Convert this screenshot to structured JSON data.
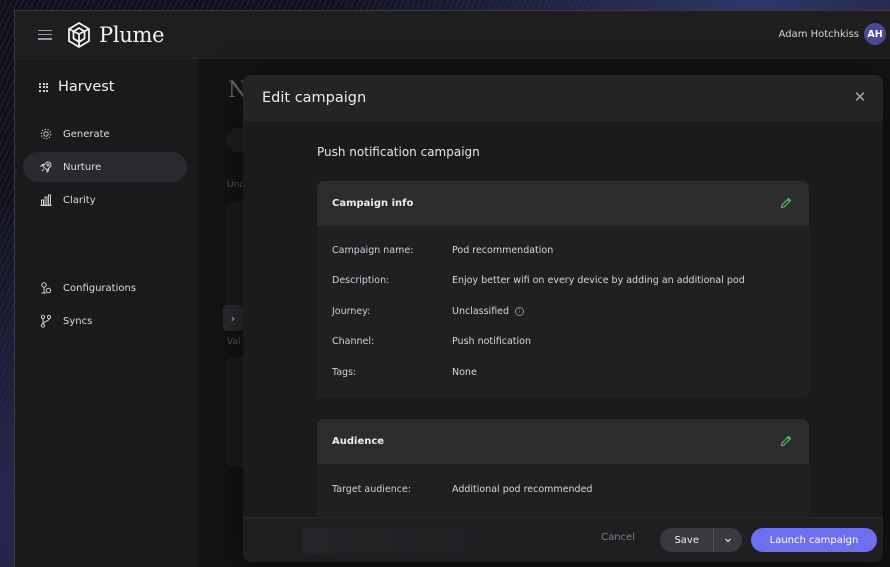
{
  "topbar": {
    "brand": "Plume",
    "user_name": "Adam Hotchkiss",
    "user_initials": "AH"
  },
  "sidebar": {
    "product": "Harvest",
    "items": [
      {
        "label": "Generate",
        "icon": "generate-icon",
        "active": false
      },
      {
        "label": "Nurture",
        "icon": "rocket-icon",
        "active": true
      },
      {
        "label": "Clarity",
        "icon": "bar-chart-icon",
        "active": false
      },
      {
        "label": "Configurations",
        "icon": "configurations-icon",
        "active": false
      },
      {
        "label": "Syncs",
        "icon": "branch-icon",
        "active": false
      }
    ]
  },
  "background": {
    "title_fragment": "N",
    "text_fragment_1": "Unc",
    "text_fragment_2": "Val"
  },
  "modal": {
    "title": "Edit campaign",
    "section_heading": "Push notification campaign",
    "campaign_info": {
      "title": "Campaign info",
      "rows": [
        {
          "key": "Campaign name:",
          "value": "Pod recommendation"
        },
        {
          "key": "Description:",
          "value": "Enjoy better wifi on every device by adding an additional pod"
        },
        {
          "key": "Journey:",
          "value": "Unclassified"
        },
        {
          "key": "Channel:",
          "value": "Push notification"
        },
        {
          "key": "Tags:",
          "value": "None"
        }
      ]
    },
    "audience": {
      "title": "Audience",
      "rows": [
        {
          "key": "Target audience:",
          "value": "Additional pod recommended"
        }
      ]
    },
    "footer": {
      "cancel": "Cancel",
      "save": "Save",
      "launch": "Launch campaign"
    }
  },
  "colors": {
    "accent": "#6d6ff0",
    "edit_icon": "#5fbf6e",
    "avatar": "#4b4a98"
  }
}
